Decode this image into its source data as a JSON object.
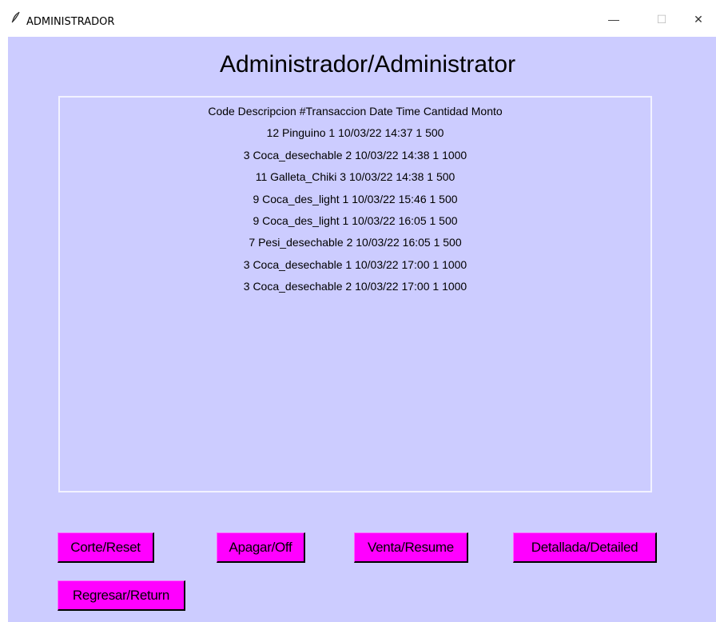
{
  "window": {
    "title": "ADMINISTRADOR",
    "minimize_glyph": "—",
    "maximize_glyph": "☐",
    "close_glyph": "✕"
  },
  "main": {
    "heading": "Administrador/Administrator",
    "list": {
      "header": "Code Descripcion #Transaccion Date Time Cantidad Monto",
      "rows": [
        "12 Pinguino 1 10/03/22 14:37 1 500",
        "3 Coca_desechable 2 10/03/22 14:38 1 1000",
        "11 Galleta_Chiki 3 10/03/22 14:38 1 500",
        "9 Coca_des_light 1 10/03/22 15:46 1 500",
        "9 Coca_des_light 1 10/03/22 16:05 1 500",
        "7 Pesi_desechable 2 10/03/22 16:05 1 500",
        "3 Coca_desechable 1 10/03/22 17:00 1 1000",
        "3 Coca_desechable 2 10/03/22 17:00 1 1000"
      ]
    },
    "buttons": {
      "reset": "Corte/Reset",
      "off": "Apagar/Off",
      "resume": "Venta/Resume",
      "detailed": "Detallada/Detailed",
      "return": "Regresar/Return"
    }
  },
  "colors": {
    "client_bg": "#ccccff",
    "button_bg": "#ff00ff",
    "listbox_border": "#f2f2ff"
  },
  "icons": {
    "app": "feather-icon",
    "minimize": "minimize-icon",
    "maximize": "maximize-icon",
    "close": "close-icon"
  }
}
